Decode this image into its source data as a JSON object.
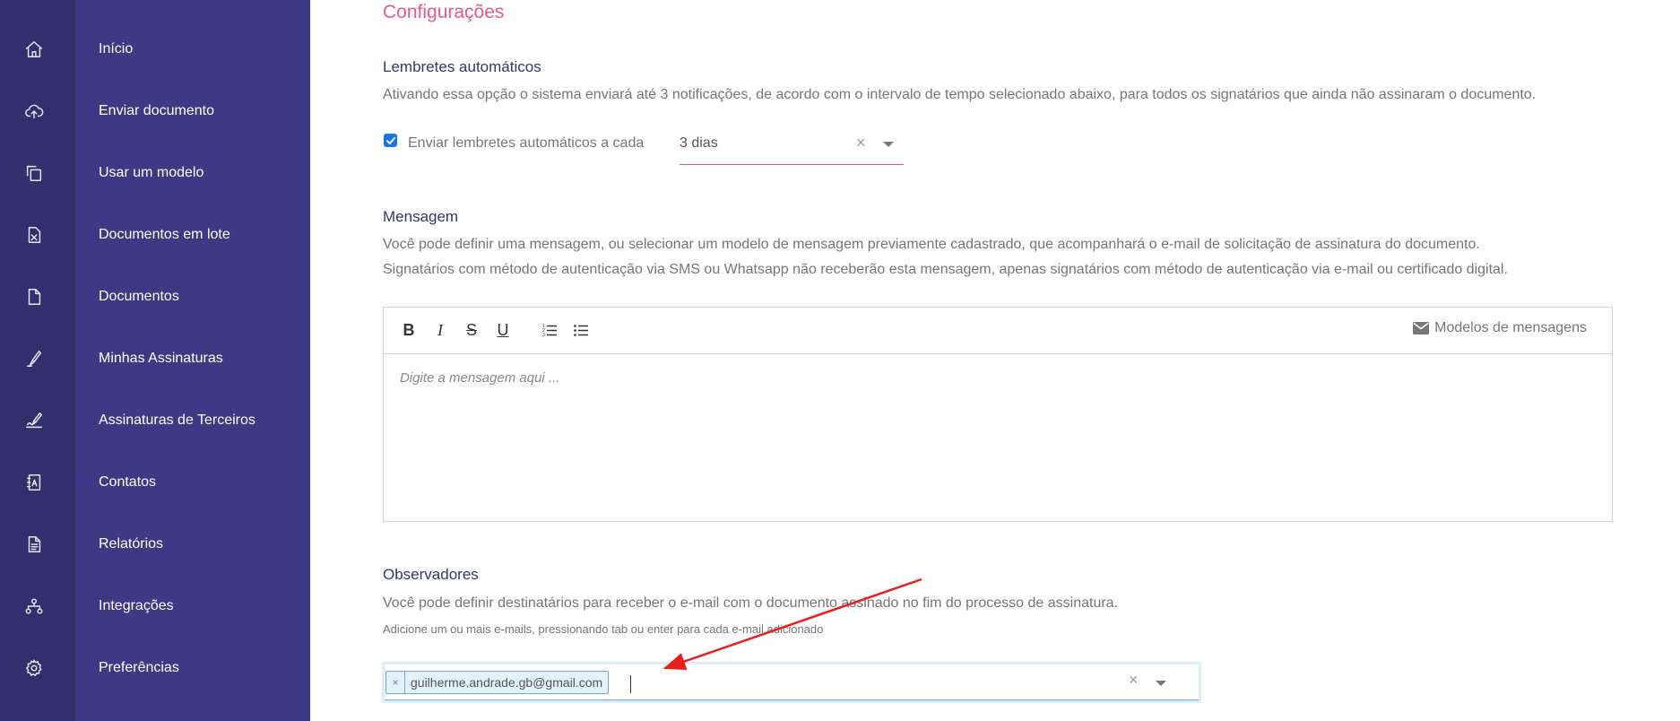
{
  "sidebar": {
    "items": [
      {
        "label": "Início",
        "icon": "home-icon"
      },
      {
        "label": "Enviar documento",
        "icon": "cloud-upload-icon"
      },
      {
        "label": "Usar um modelo",
        "icon": "template-copy-icon"
      },
      {
        "label": "Documentos em lote",
        "icon": "spreadsheet-file-icon"
      },
      {
        "label": "Documentos",
        "icon": "document-icon"
      },
      {
        "label": "Minhas Assinaturas",
        "icon": "pen-icon"
      },
      {
        "label": "Assinaturas de Terceiros",
        "icon": "third-party-signature-icon"
      },
      {
        "label": "Contatos",
        "icon": "contacts-book-icon"
      },
      {
        "label": "Relatórios",
        "icon": "report-icon"
      },
      {
        "label": "Integrações",
        "icon": "integrations-icon"
      },
      {
        "label": "Preferências",
        "icon": "gear-icon"
      }
    ]
  },
  "page": {
    "title": "Configurações"
  },
  "reminders": {
    "title": "Lembretes automáticos",
    "description": "Ativando essa opção o sistema enviará até 3 notificações, de acordo com o intervalo de tempo selecionado abaixo, para todos os signatários que ainda não assinaram o documento.",
    "checkbox_label": "Enviar lembretes automáticos a cada",
    "checked": true,
    "interval_value": "3 dias",
    "clear_symbol": "×"
  },
  "message": {
    "title": "Mensagem",
    "description_1": "Você pode definir uma mensagem, ou selecionar um modelo de mensagem previamente cadastrado, que acompanhará o e-mail de solicitação de assinatura do documento.",
    "description_2": "Signatários com método de autenticação via SMS ou Whatsapp não receberão esta mensagem, apenas signatários com método de autenticação via e-mail ou certificado digital.",
    "toolbar": {
      "bold": "B",
      "italic": "I",
      "strike": "S",
      "underline": "U",
      "models_label": "Modelos de mensagens"
    },
    "placeholder": "Digite a mensagem aqui ..."
  },
  "observers": {
    "title": "Observadores",
    "description": "Você pode definir destinatários para receber o e-mail com o documento assinado no fim do processo de assinatura.",
    "hint": "Adicione um ou mais e-mails, pressionando tab ou enter para cada e-mail adicionado",
    "tags": [
      "guilherme.andrade.gb@gmail.com"
    ],
    "tag_remove_symbol": "×",
    "clear_symbol": "×"
  },
  "colors": {
    "icon_rail": "#342e6e",
    "sidebar": "#3f3985",
    "title_accent": "#e6578d",
    "section_title": "#2f3a66",
    "select_underline": "#c9599b",
    "annotation_arrow": "#e8201c"
  }
}
